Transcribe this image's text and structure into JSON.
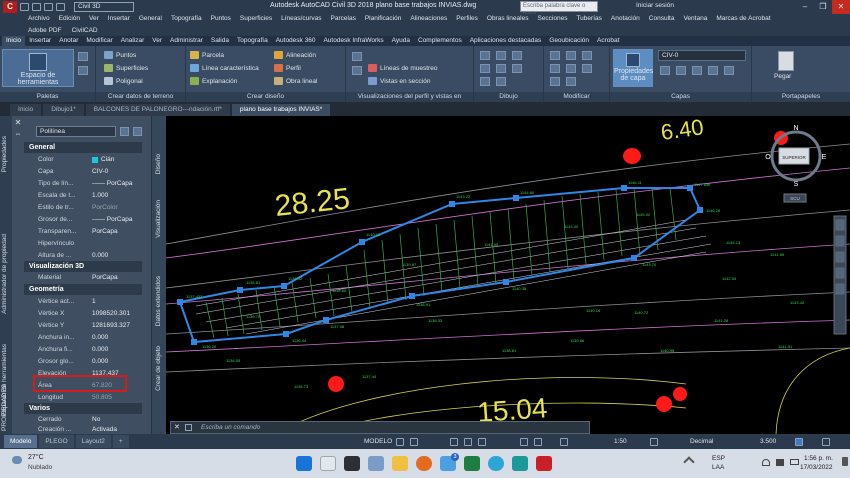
{
  "app": {
    "workspace": "Civil 3D",
    "window_title": "Autodesk AutoCAD Civil 3D 2018   plano base trabajos INVIAS.dwg",
    "search_placeholder": "Escriba palabra clave o frase",
    "sign_in": "Iniciar sesión"
  },
  "menubar": [
    "Archivo",
    "Edición",
    "Ver",
    "Insertar",
    "General",
    "Topografía",
    "Puntos",
    "Superficies",
    "Líneas/curvas",
    "Parcelas",
    "Planificación",
    "Alineaciones",
    "Perfiles",
    "Obras lineales",
    "Secciones",
    "Tuberías",
    "Anotación",
    "Consulta",
    "Ventana",
    "Marcas de Acrobat"
  ],
  "addon_row": [
    "Adobe PDF",
    "CivilCAD"
  ],
  "ribbon_tabs": [
    "Inicio",
    "Insertar",
    "Anotar",
    "Modificar",
    "Analizar",
    "Ver",
    "Administrar",
    "Salida",
    "Topografía",
    "Autodesk 360",
    "Autodesk InfraWorks",
    "Ayuda",
    "Complementos",
    "Aplicaciones destacadas",
    "Geoubicación",
    "Acrobat"
  ],
  "ribbon": {
    "palettes_button": "Espacio de herramientas",
    "palettes_title": "Paletas",
    "ground_items": [
      "Puntos",
      "Superficies",
      "Poligonal"
    ],
    "ground_title": "Crear datos de terreno",
    "design_items": [
      "Parcela",
      "Línea característica",
      "Explanación",
      "Alineación",
      "Perfil",
      "Obra lineal"
    ],
    "design_title": "Crear diseño",
    "profile_items": [
      "Líneas de muestreo",
      "Vistas en sección"
    ],
    "profile_title": "Visualizaciones del perfil y vistas en sección",
    "draw_title": "Dibujo",
    "modify_title": "Modificar",
    "layer_props": "Propiedades de capa",
    "layer_current": "CIV-0",
    "layers_title": "Capas",
    "paste": "Pegar",
    "clipboard_title": "Portapapeles"
  },
  "doc_tabs": [
    "Inicio",
    "Dibujo1*",
    "BALCONES DE PALONEGRO---ndación.rtf*",
    "plano base trabajos INVIAS*"
  ],
  "side_labels": [
    "Propiedades",
    "Administrador de propiedad",
    "Espacio de herramientas",
    "PROPIEDADES"
  ],
  "props_side_labels": [
    "Diseño",
    "Visualización",
    "Datos extendidos",
    "Crear de objeto"
  ],
  "properties": {
    "object_type": "Polilínea",
    "sections": [
      {
        "title": "General",
        "rows": [
          {
            "k": "Color",
            "v": "Cián"
          },
          {
            "k": "Capa",
            "v": "CIV-0"
          },
          {
            "k": "Tipo de lín...",
            "v": "—— PorCapa"
          },
          {
            "k": "Escala de t...",
            "v": "1.000"
          },
          {
            "k": "Estilo de tr...",
            "v": "PorColor"
          },
          {
            "k": "Grosor de...",
            "v": "—— PorCapa"
          },
          {
            "k": "Transparen...",
            "v": "PorCapa"
          },
          {
            "k": "Hipervínculo",
            "v": ""
          },
          {
            "k": "Altura de ...",
            "v": "0.000"
          }
        ]
      },
      {
        "title": "Visualización 3D",
        "rows": [
          {
            "k": "Material",
            "v": "PorCapa"
          }
        ]
      },
      {
        "title": "Geometría",
        "rows": [
          {
            "k": "Vértice act...",
            "v": "1"
          },
          {
            "k": "Vértice X",
            "v": "1098520.301"
          },
          {
            "k": "Vértice Y",
            "v": "1281693.327"
          },
          {
            "k": "Anchura in...",
            "v": "0.000"
          },
          {
            "k": "Anchura fi...",
            "v": "0.000"
          },
          {
            "k": "Grosor glo...",
            "v": "0.000"
          },
          {
            "k": "Elevación",
            "v": "1137.437"
          },
          {
            "k": "Área",
            "v": "67.820"
          },
          {
            "k": "Longitud",
            "v": "50.805"
          }
        ]
      },
      {
        "title": "Varios",
        "rows": [
          {
            "k": "Cerrado",
            "v": "No"
          },
          {
            "k": "Creación ...",
            "v": "Activada"
          }
        ]
      }
    ]
  },
  "canvas": {
    "labels": [
      "28.25",
      "6.40",
      "15.04"
    ],
    "viewcube": {
      "n": "N",
      "s": "S",
      "e": "E",
      "o": "O",
      "face": "SUPERIOR",
      "ucs": "SCU"
    }
  },
  "command_line": "Escriba un comando",
  "layout_tabs": [
    "Modelo",
    "PLEGO",
    "Layout2"
  ],
  "status": {
    "model": "MODELO",
    "scale": "1:50",
    "units": "Decimal",
    "value": "3.500"
  },
  "taskbar": {
    "temp": "27°C",
    "weather": "Nublado",
    "lang": "ESP",
    "lang2": "LAA",
    "time": "1:56 p. m.",
    "date": "17/03/2022",
    "badge": "3"
  }
}
